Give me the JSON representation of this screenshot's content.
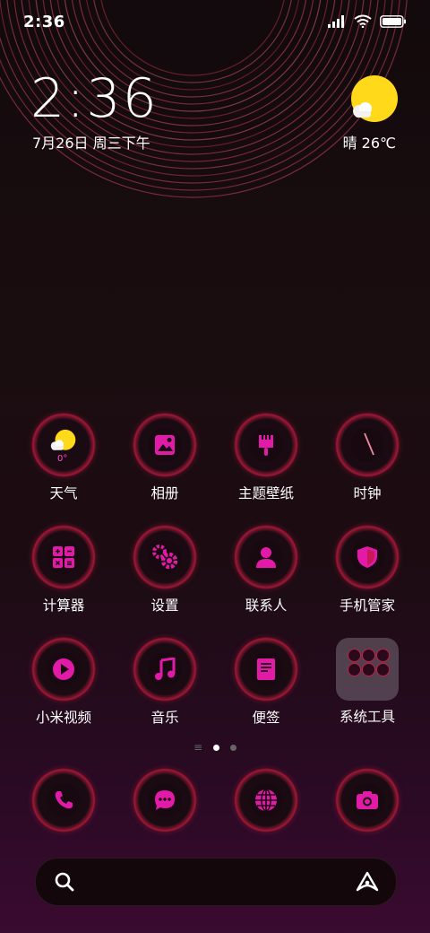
{
  "status_bar": {
    "time": "2:36"
  },
  "clock_widget": {
    "time": "2:36",
    "date": "7月26日 周三下午",
    "weather": "晴 26℃"
  },
  "apps": [
    {
      "label": "天气",
      "icon": "weather-icon",
      "badge": "0°"
    },
    {
      "label": "相册",
      "icon": "gallery-icon"
    },
    {
      "label": "主题壁纸",
      "icon": "brush-icon"
    },
    {
      "label": "时钟",
      "icon": "clock-icon"
    },
    {
      "label": "计算器",
      "icon": "calculator-icon"
    },
    {
      "label": "设置",
      "icon": "gear-icon"
    },
    {
      "label": "联系人",
      "icon": "contact-icon"
    },
    {
      "label": "手机管家",
      "icon": "shield-icon"
    },
    {
      "label": "小米视频",
      "icon": "play-icon"
    },
    {
      "label": "音乐",
      "icon": "music-icon"
    },
    {
      "label": "便签",
      "icon": "note-icon"
    },
    {
      "label": "系统工具",
      "icon": "folder-icon"
    }
  ],
  "dock": [
    {
      "icon": "phone-icon"
    },
    {
      "icon": "message-icon"
    },
    {
      "icon": "browser-icon"
    },
    {
      "icon": "camera-icon"
    }
  ],
  "pager": {
    "pages": 2,
    "current": 1
  },
  "colors": {
    "accent": "#e21aa8",
    "ring": "#c01f48",
    "sun": "#ffd91a"
  }
}
